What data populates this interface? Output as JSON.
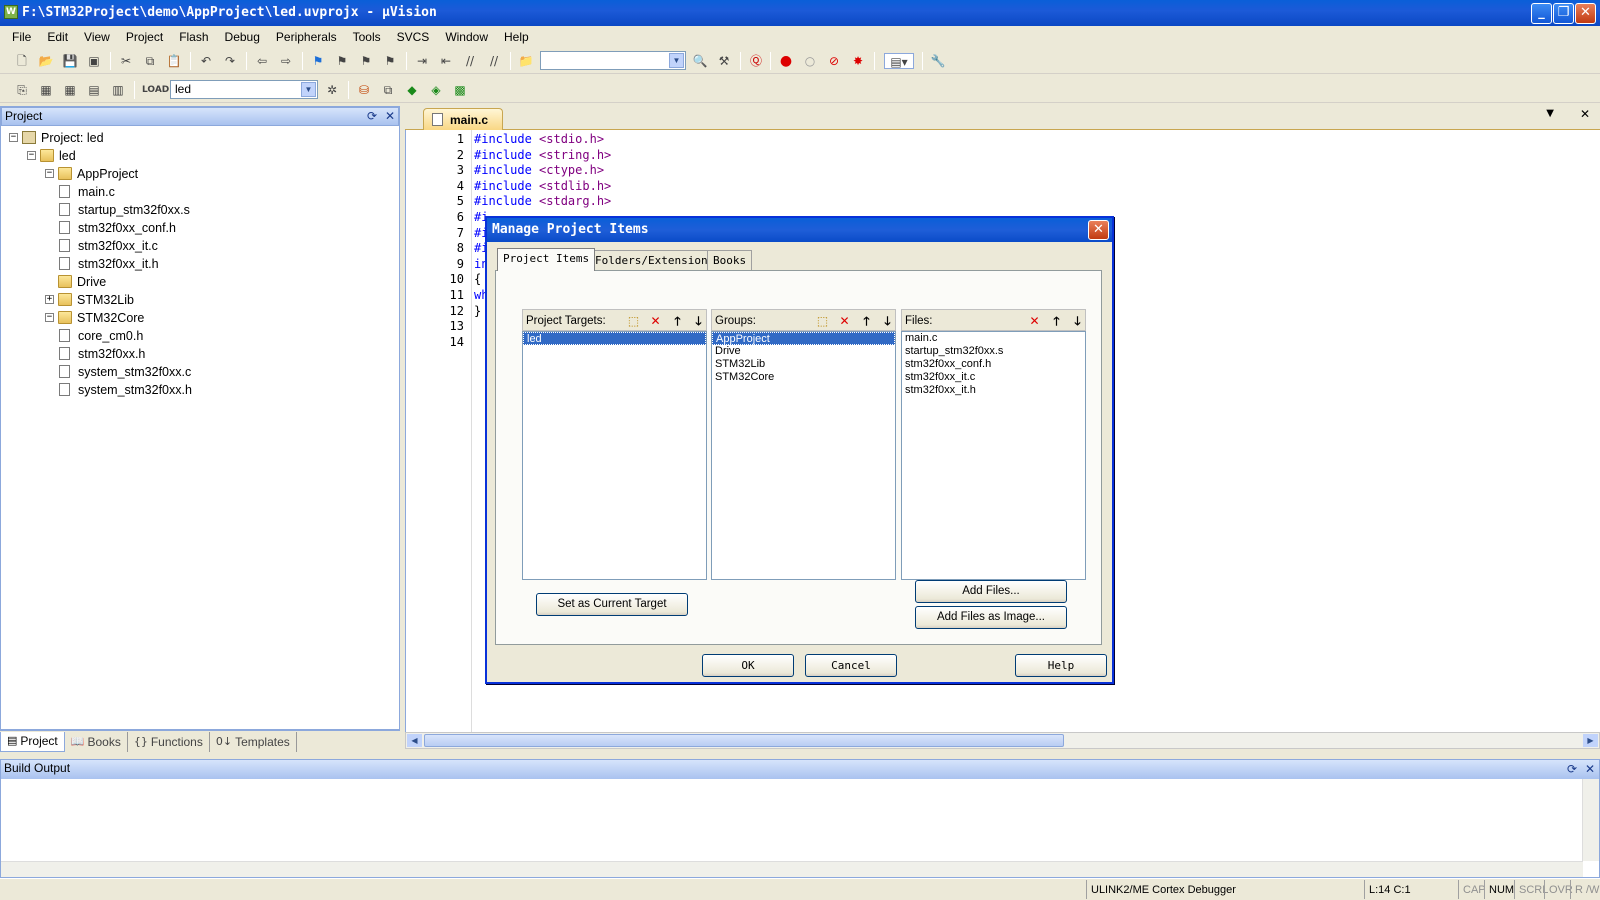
{
  "window": {
    "title": "F:\\STM32Project\\demo\\AppProject\\led.uvprojx - µVision"
  },
  "menu": [
    "File",
    "Edit",
    "View",
    "Project",
    "Flash",
    "Debug",
    "Peripherals",
    "Tools",
    "SVCS",
    "Window",
    "Help"
  ],
  "toolbar": {
    "target_combo": "led"
  },
  "project_panel": {
    "title": "Project",
    "tree": [
      {
        "label": "Project: led",
        "level": 0,
        "type": "project",
        "expander": "-"
      },
      {
        "label": "led",
        "level": 1,
        "type": "folder",
        "expander": "-"
      },
      {
        "label": "AppProject",
        "level": 2,
        "type": "folder",
        "expander": "-"
      },
      {
        "label": "main.c",
        "level": 3,
        "type": "file"
      },
      {
        "label": "startup_stm32f0xx.s",
        "level": 3,
        "type": "file"
      },
      {
        "label": "stm32f0xx_conf.h",
        "level": 3,
        "type": "file"
      },
      {
        "label": "stm32f0xx_it.c",
        "level": 3,
        "type": "file"
      },
      {
        "label": "stm32f0xx_it.h",
        "level": 3,
        "type": "file"
      },
      {
        "label": "Drive",
        "level": 2,
        "type": "folder"
      },
      {
        "label": "STM32Lib",
        "level": 2,
        "type": "folder",
        "expander": "+"
      },
      {
        "label": "STM32Core",
        "level": 2,
        "type": "folder",
        "expander": "-"
      },
      {
        "label": "core_cm0.h",
        "level": 3,
        "type": "file"
      },
      {
        "label": "stm32f0xx.h",
        "level": 3,
        "type": "file"
      },
      {
        "label": "system_stm32f0xx.c",
        "level": 3,
        "type": "file"
      },
      {
        "label": "system_stm32f0xx.h",
        "level": 3,
        "type": "file"
      }
    ],
    "tabs": [
      "Project",
      "Books",
      "Functions",
      "Templates"
    ]
  },
  "editor": {
    "tab": "main.c",
    "line_numbers": [
      "1",
      "2",
      "3",
      "4",
      "5",
      "6",
      "7",
      "8",
      "9",
      "10",
      "11",
      "12",
      "13",
      "14"
    ],
    "lines": [
      {
        "kw": "#include",
        "rest": " <stdio.h>"
      },
      {
        "kw": "#include",
        "rest": " <string.h>"
      },
      {
        "kw": "#include",
        "rest": " <ctype.h>"
      },
      {
        "kw": "#include",
        "rest": " <stdlib.h>"
      },
      {
        "kw": "#include",
        "rest": " <stdarg.h>"
      },
      {
        "kw": "#i",
        "rest": ""
      },
      {
        "kw": "#i",
        "rest": ""
      },
      {
        "kw": "#i",
        "rest": ""
      },
      {
        "kw": "in",
        "rest": ""
      },
      {
        "kw": "",
        "rest": "{"
      },
      {
        "kw": "wh",
        "rest": ""
      },
      {
        "kw": "",
        "rest": "}"
      },
      {
        "kw": "",
        "rest": ""
      },
      {
        "kw": "",
        "rest": ""
      }
    ]
  },
  "dialog": {
    "title": "Manage Project Items",
    "tabs": [
      "Project Items",
      "Folders/Extensions",
      "Books"
    ],
    "targets": {
      "label": "Project Targets:",
      "items": [
        "led"
      ],
      "selected": 0
    },
    "groups": {
      "label": "Groups:",
      "items": [
        "AppProject",
        "Drive",
        "STM32Lib",
        "STM32Core"
      ],
      "selected": 0
    },
    "files": {
      "label": "Files:",
      "items": [
        "main.c",
        "startup_stm32f0xx.s",
        "stm32f0xx_conf.h",
        "stm32f0xx_it.c",
        "stm32f0xx_it.h"
      ]
    },
    "set_current_target": "Set as Current Target",
    "add_files": "Add Files...",
    "add_files_image": "Add Files as Image...",
    "ok": "OK",
    "cancel": "Cancel",
    "help": "Help"
  },
  "build_output": {
    "title": "Build Output"
  },
  "status": {
    "debugger": "ULINK2/ME Cortex Debugger",
    "position": "L:14 C:1",
    "cap": "CAP",
    "num": "NUM",
    "scrl": "SCRL",
    "ovr": "OVR",
    "rw": "R /W"
  }
}
